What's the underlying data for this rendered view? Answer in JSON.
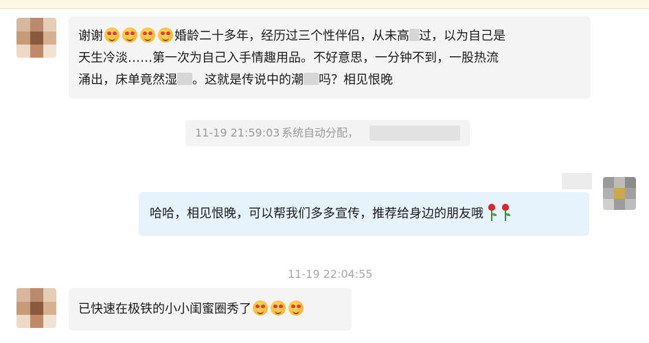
{
  "messages": [
    {
      "from": "customer",
      "parts": {
        "p1": "谢谢",
        "p2": "婚龄二十多年，经历过三个性伴侣，从未高",
        "p3": "过，以为自己是",
        "line2": "天生冷淡……第一次为自己入手情趣用品。不好意思，一分钟不到，一股热流",
        "p4": "涌出，床单竟然湿",
        "p5": "。这就是传说中的潮",
        "p6": "吗？相见恨晚"
      }
    },
    {
      "from": "agent",
      "text": "哈哈，相见恨晚，可以帮我们多多宣传，推荐给身边的朋友哦"
    },
    {
      "from": "customer",
      "text": "已快速在极铁的小小闺蜜圈秀了"
    }
  ],
  "system_notice": {
    "timestamp": "11-19 21:59:03",
    "text": "系统自动分配，"
  },
  "timestamps": {
    "second": "11-19 22:04:55"
  },
  "icons": {
    "emoji": "heart-eyes-emoji",
    "rose": "rose-emoji"
  }
}
